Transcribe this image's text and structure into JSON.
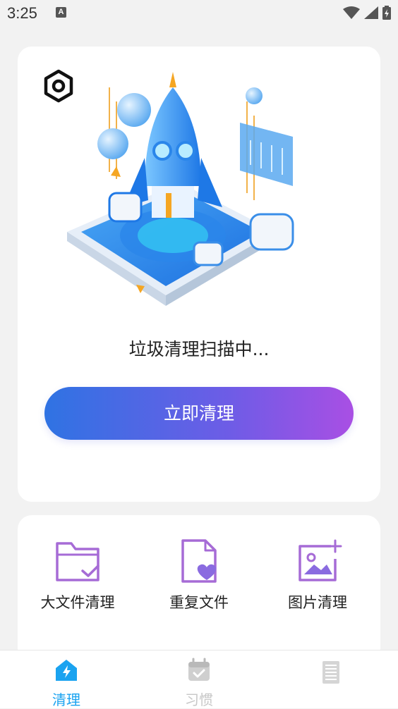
{
  "status_bar": {
    "time": "3:25",
    "notif_badge": "A"
  },
  "hero": {
    "scan_status": "垃圾清理扫描中...",
    "clean_button_label": "立即清理"
  },
  "tools": [
    {
      "label": "大文件清理",
      "icon": "folder-check-icon"
    },
    {
      "label": "重复文件",
      "icon": "file-heart-icon"
    },
    {
      "label": "图片清理",
      "icon": "image-plus-icon"
    }
  ],
  "nav": [
    {
      "label": "清理",
      "icon": "home-bolt-icon",
      "active": true
    },
    {
      "label": "习惯",
      "icon": "calendar-check-icon",
      "active": false
    },
    {
      "label": "",
      "icon": "document-list-icon",
      "active": false
    }
  ],
  "colors": {
    "accent": "#1aa3f0",
    "purple": "#a66bd6",
    "btn_start": "#2f73e3",
    "btn_end": "#a94fe4"
  }
}
